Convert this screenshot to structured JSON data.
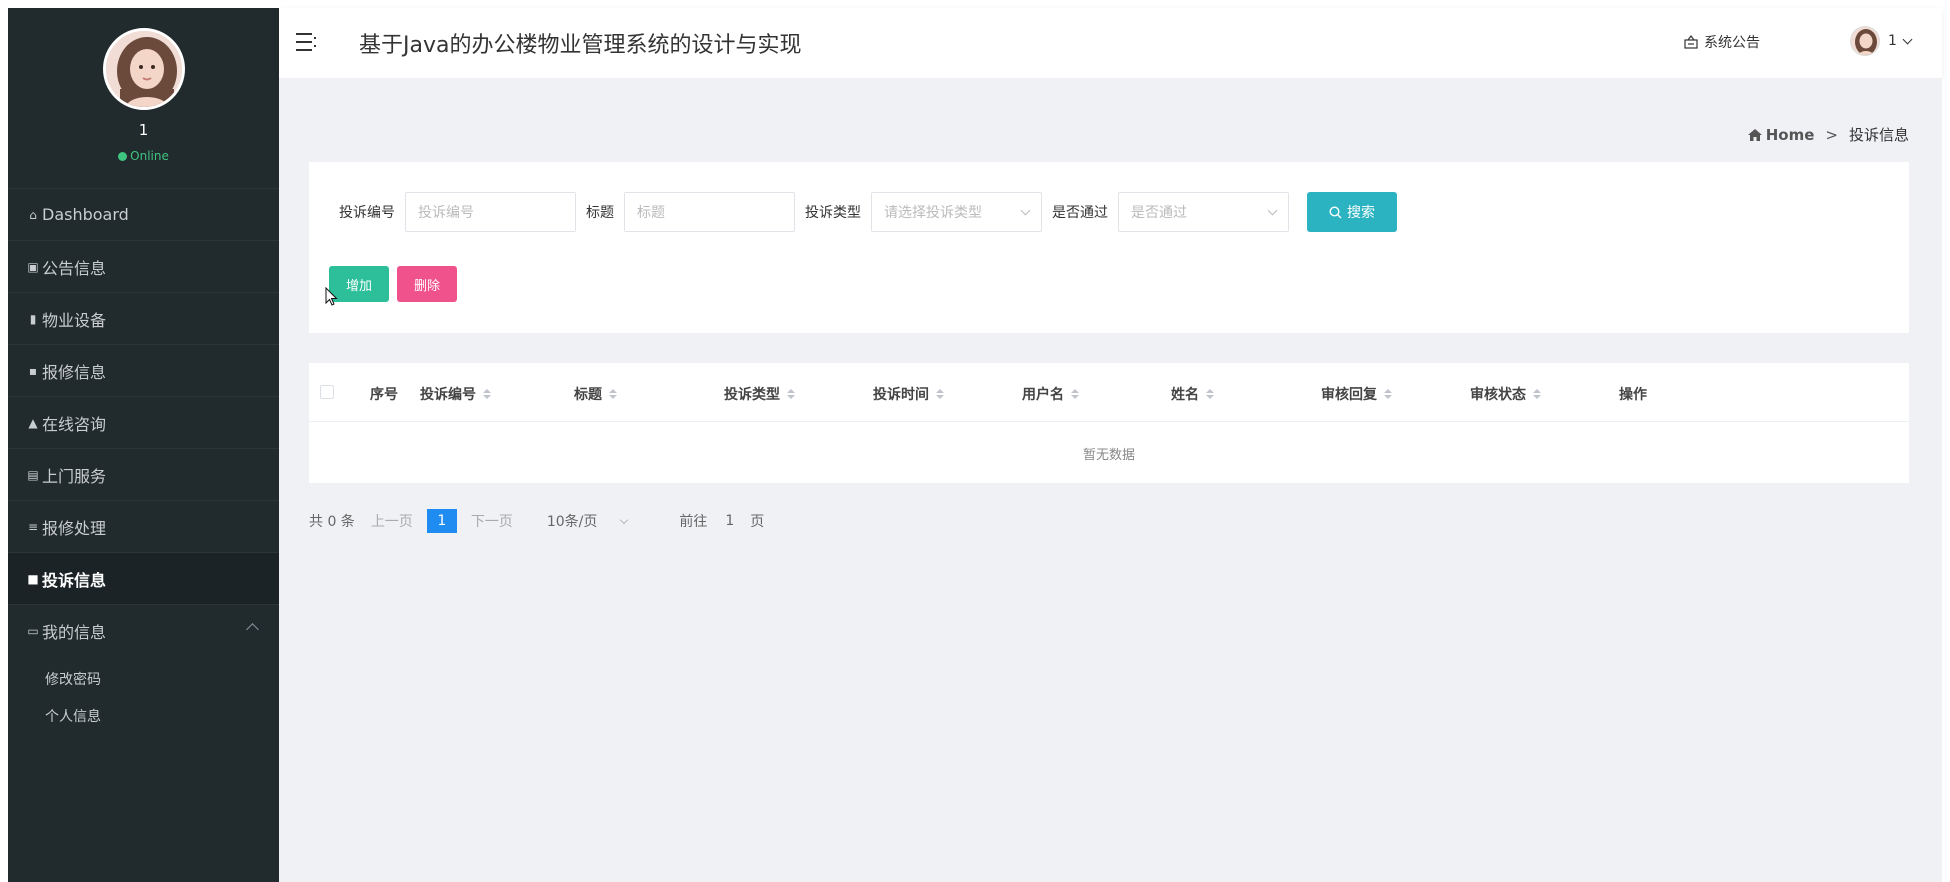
{
  "sidebar": {
    "user_name": "1",
    "status": "Online",
    "items": [
      {
        "label": "Dashboard",
        "icon": "home-icon"
      },
      {
        "label": "公告信息",
        "icon": "notice-icon"
      },
      {
        "label": "物业设备",
        "icon": "bar-chart-icon"
      },
      {
        "label": "报修信息",
        "icon": "grid-icon"
      },
      {
        "label": "在线咨询",
        "icon": "user-icon"
      },
      {
        "label": "上门服务",
        "icon": "doc-icon"
      },
      {
        "label": "报修处理",
        "icon": "list-icon"
      },
      {
        "label": "投诉信息",
        "icon": "folder-icon"
      },
      {
        "label": "我的信息",
        "icon": "card-icon"
      }
    ],
    "submenu": [
      {
        "label": "修改密码"
      },
      {
        "label": "个人信息"
      }
    ]
  },
  "header": {
    "title": "基于Java的办公楼物业管理系统的设计与实现",
    "notice_label": "系统公告",
    "user_label": "1"
  },
  "breadcrumb": {
    "home": "Home",
    "sep": ">",
    "current": "投诉信息"
  },
  "search": {
    "fields": [
      {
        "label": "投诉编号",
        "placeholder": "投诉编号"
      },
      {
        "label": "标题",
        "placeholder": "标题"
      },
      {
        "label": "投诉类型",
        "placeholder": "请选择投诉类型"
      },
      {
        "label": "是否通过",
        "placeholder": "是否通过"
      }
    ],
    "search_button": "搜索",
    "add_button": "增加",
    "delete_button": "删除"
  },
  "table": {
    "columns": [
      "序号",
      "投诉编号",
      "标题",
      "投诉类型",
      "投诉时间",
      "用户名",
      "姓名",
      "审核回复",
      "审核状态",
      "操作"
    ],
    "empty_text": "暂无数据"
  },
  "pager": {
    "total": "共 0 条",
    "prev": "上一页",
    "current": "1",
    "next": "下一页",
    "page_size": "10条/页",
    "goto_label": "前往",
    "goto_value": "1",
    "page_unit": "页"
  },
  "colors": {
    "sidebar_bg": "#212a2d",
    "search_button": "#2bb3c1",
    "add_button": "#2dbf9a",
    "delete_button": "#f0538c",
    "pager_current": "#1e8cf0",
    "online": "#3fc380"
  }
}
